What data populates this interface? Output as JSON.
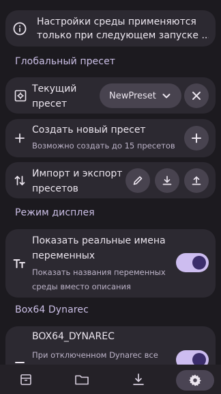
{
  "info": {
    "line1": "Настройки среды применяются",
    "line2": "только при следующем запуске ..."
  },
  "sections": {
    "global_preset": "Глобальный пресет",
    "display_mode": "Режим дисплея",
    "box64_dynarec": "Box64 Dynarec"
  },
  "current_preset": {
    "label_line1": "Текущий",
    "label_line2": "пресет",
    "selected": "NewPreset"
  },
  "create_preset": {
    "title": "Создать новый пресет",
    "subtitle": "Возможно создать до 15 пресетов"
  },
  "import_export": {
    "line1": "Импорт и экспорт",
    "line2": "пресетов"
  },
  "show_names": {
    "title_line1": "Показать реальные имена",
    "title_line2": "переменных",
    "subtitle_line1": "Показать названия переменных",
    "subtitle_line2": "среды вместо описания",
    "enabled": true
  },
  "box64": {
    "title": "BOX64_DYNAREC",
    "subtitle": "При отключенном Dynarec все",
    "enabled": true
  },
  "colors": {
    "background": "#1c1a1f",
    "card": "#2c2931",
    "accent_toggle": "#cdbdf0",
    "section_title": "#cbbfe6"
  },
  "icons": {
    "info": "info-circle-icon",
    "preset": "settings-box-icon",
    "add": "plus-icon",
    "import_export": "swap-vertical-icon",
    "edit": "pencil-icon",
    "download": "download-icon",
    "upload": "upload-icon",
    "display": "text-size-icon",
    "dynarec": "minus-icon",
    "nav": [
      "archive-icon",
      "folder-icon",
      "download-icon",
      "settings-gear-icon"
    ]
  }
}
